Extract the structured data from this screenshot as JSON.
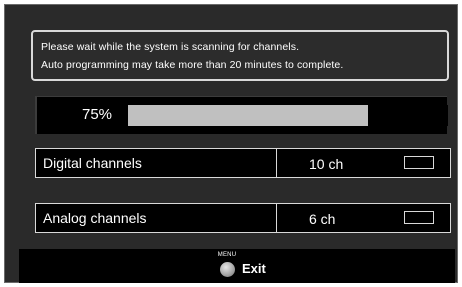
{
  "message": {
    "line1": "Please wait while the system is scanning for channels.",
    "line2": "Auto programming may take more than 20 minutes to complete."
  },
  "progress": {
    "label": "75%",
    "fraction": 0.75,
    "fill_color": "#c0c0c0"
  },
  "channels": [
    {
      "label": "Digital channels",
      "count": "10 ch"
    },
    {
      "label": "Analog channels",
      "count": "6 ch"
    }
  ],
  "footer": {
    "menu_label": "MENU",
    "exit_label": "Exit",
    "button_icon": "menu-button-icon"
  },
  "colors": {
    "background": "#2a2a2a",
    "panel": "#000000",
    "text": "#ffffff",
    "border": "#d9d9d9"
  }
}
